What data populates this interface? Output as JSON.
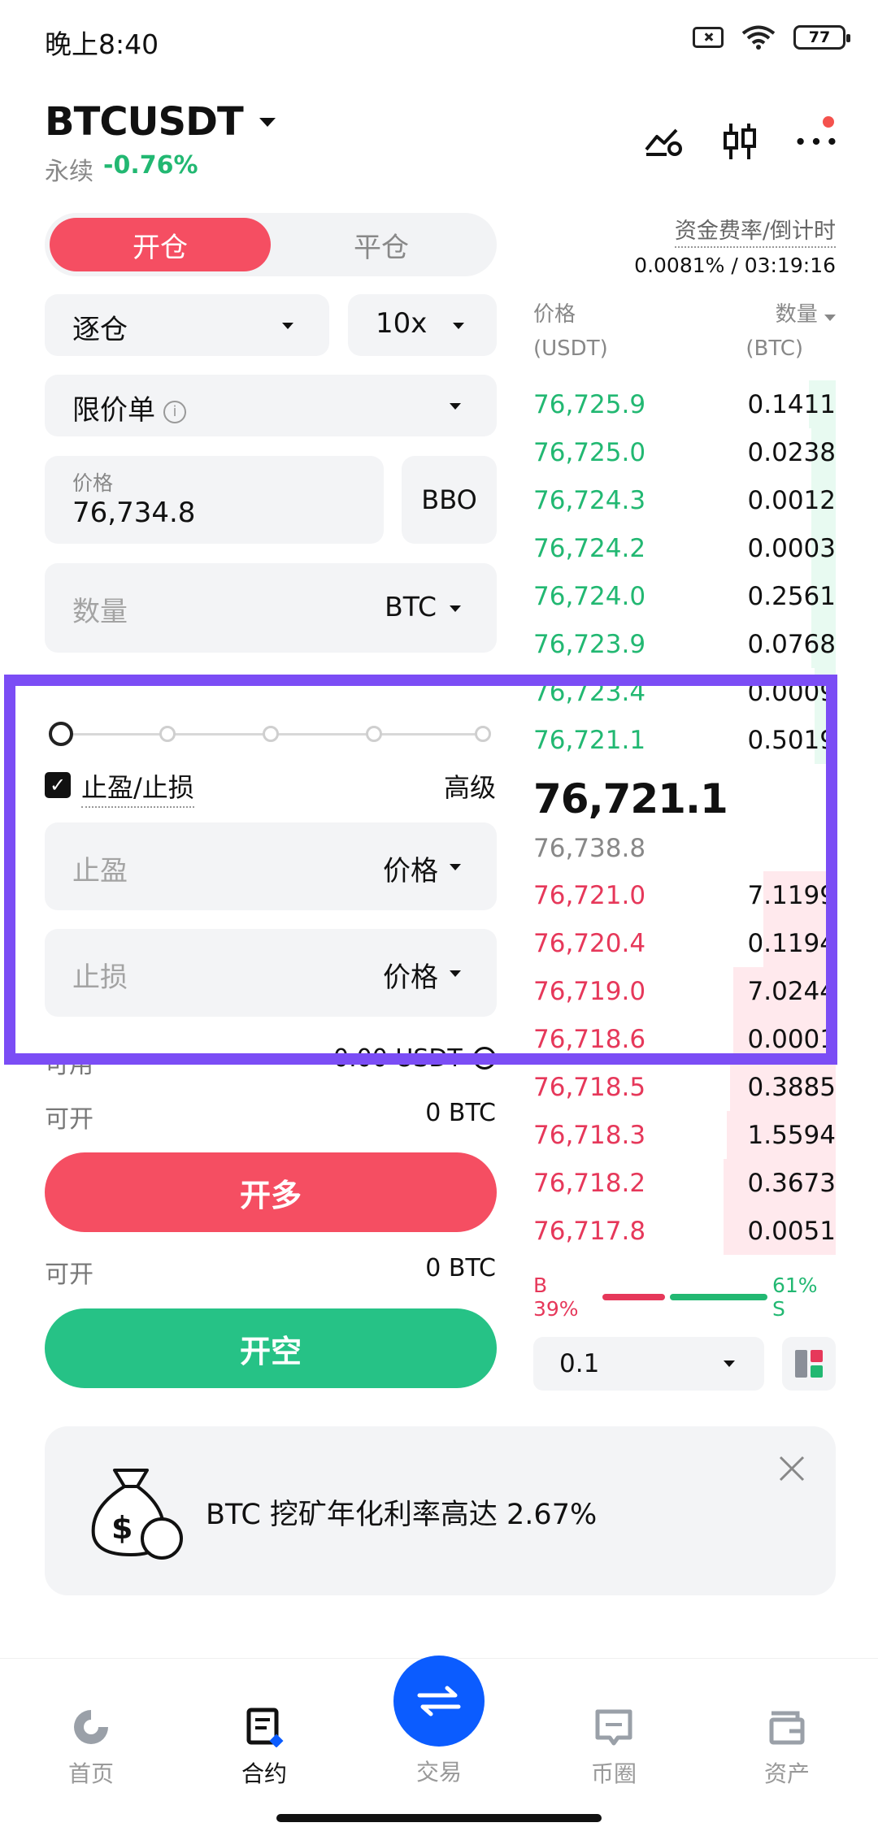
{
  "status_bar": {
    "time": "晚上8:40",
    "battery": "77"
  },
  "header": {
    "pair": "BTCUSDT",
    "contract_type": "永续",
    "change": "-0.76%"
  },
  "form": {
    "tabs": {
      "open": "开仓",
      "close": "平仓"
    },
    "margin_mode": "逐仓",
    "leverage": "10x",
    "order_type": "限价单",
    "price_label": "价格",
    "price_value": "76,734.8",
    "bbo_label": "BBO",
    "qty_placeholder": "数量",
    "qty_unit": "BTC",
    "tpsl_label": "止盈/止损",
    "advanced": "高级",
    "tp_placeholder": "止盈",
    "tp_type": "价格",
    "sl_placeholder": "止损",
    "sl_type": "价格",
    "available_label": "可用",
    "available_value": "0.00 USDT",
    "can_open_label": "可开",
    "can_open_long": "0 BTC",
    "can_open_short": "0 BTC",
    "long_button": "开多",
    "short_button": "开空"
  },
  "orderbook": {
    "funding_label": "资金费率/倒计时",
    "funding_value": "0.0081% / 03:19:16",
    "price_header": "价格",
    "price_unit": "(USDT)",
    "qty_header": "数量",
    "qty_unit": "(BTC)",
    "asks": [
      {
        "price": "76,725.9",
        "qty": "0.1411",
        "depth": 0.09
      },
      {
        "price": "76,725.0",
        "qty": "0.0238",
        "depth": 0.08
      },
      {
        "price": "76,724.3",
        "qty": "0.0012",
        "depth": 0.08
      },
      {
        "price": "76,724.2",
        "qty": "0.0003",
        "depth": 0.08
      },
      {
        "price": "76,724.0",
        "qty": "0.2561",
        "depth": 0.08
      },
      {
        "price": "76,723.9",
        "qty": "0.0768",
        "depth": 0.08
      },
      {
        "price": "76,723.4",
        "qty": "0.0009",
        "depth": 0.07
      },
      {
        "price": "76,721.1",
        "qty": "0.5019",
        "depth": 0.07
      }
    ],
    "last_price": "76,721.1",
    "mark_price": "76,738.8",
    "bids": [
      {
        "price": "76,721.0",
        "qty": "7.1199",
        "depth": 0.24
      },
      {
        "price": "76,720.4",
        "qty": "0.1194",
        "depth": 0.24
      },
      {
        "price": "76,719.0",
        "qty": "7.0244",
        "depth": 0.34
      },
      {
        "price": "76,718.6",
        "qty": "0.0001",
        "depth": 0.34
      },
      {
        "price": "76,718.5",
        "qty": "0.3885",
        "depth": 0.35
      },
      {
        "price": "76,718.3",
        "qty": "1.5594",
        "depth": 0.36
      },
      {
        "price": "76,718.2",
        "qty": "0.3673",
        "depth": 0.37
      },
      {
        "price": "76,717.8",
        "qty": "0.0051",
        "depth": 0.37
      }
    ],
    "buy_ratio": "B 39%",
    "sell_ratio": "61% S",
    "buy_pct": 39,
    "sell_pct": 61,
    "depth_step": "0.1"
  },
  "promo": {
    "text": "BTC 挖矿年化利率高达 2.67%"
  },
  "bottom_nav": {
    "home": "首页",
    "contract": "合约",
    "trade": "交易",
    "community": "币圈",
    "assets": "资产"
  },
  "colors": {
    "red": "#f54e62",
    "green": "#26c286",
    "highlight": "#7b4df5",
    "nav_blue": "#0b5cff"
  }
}
